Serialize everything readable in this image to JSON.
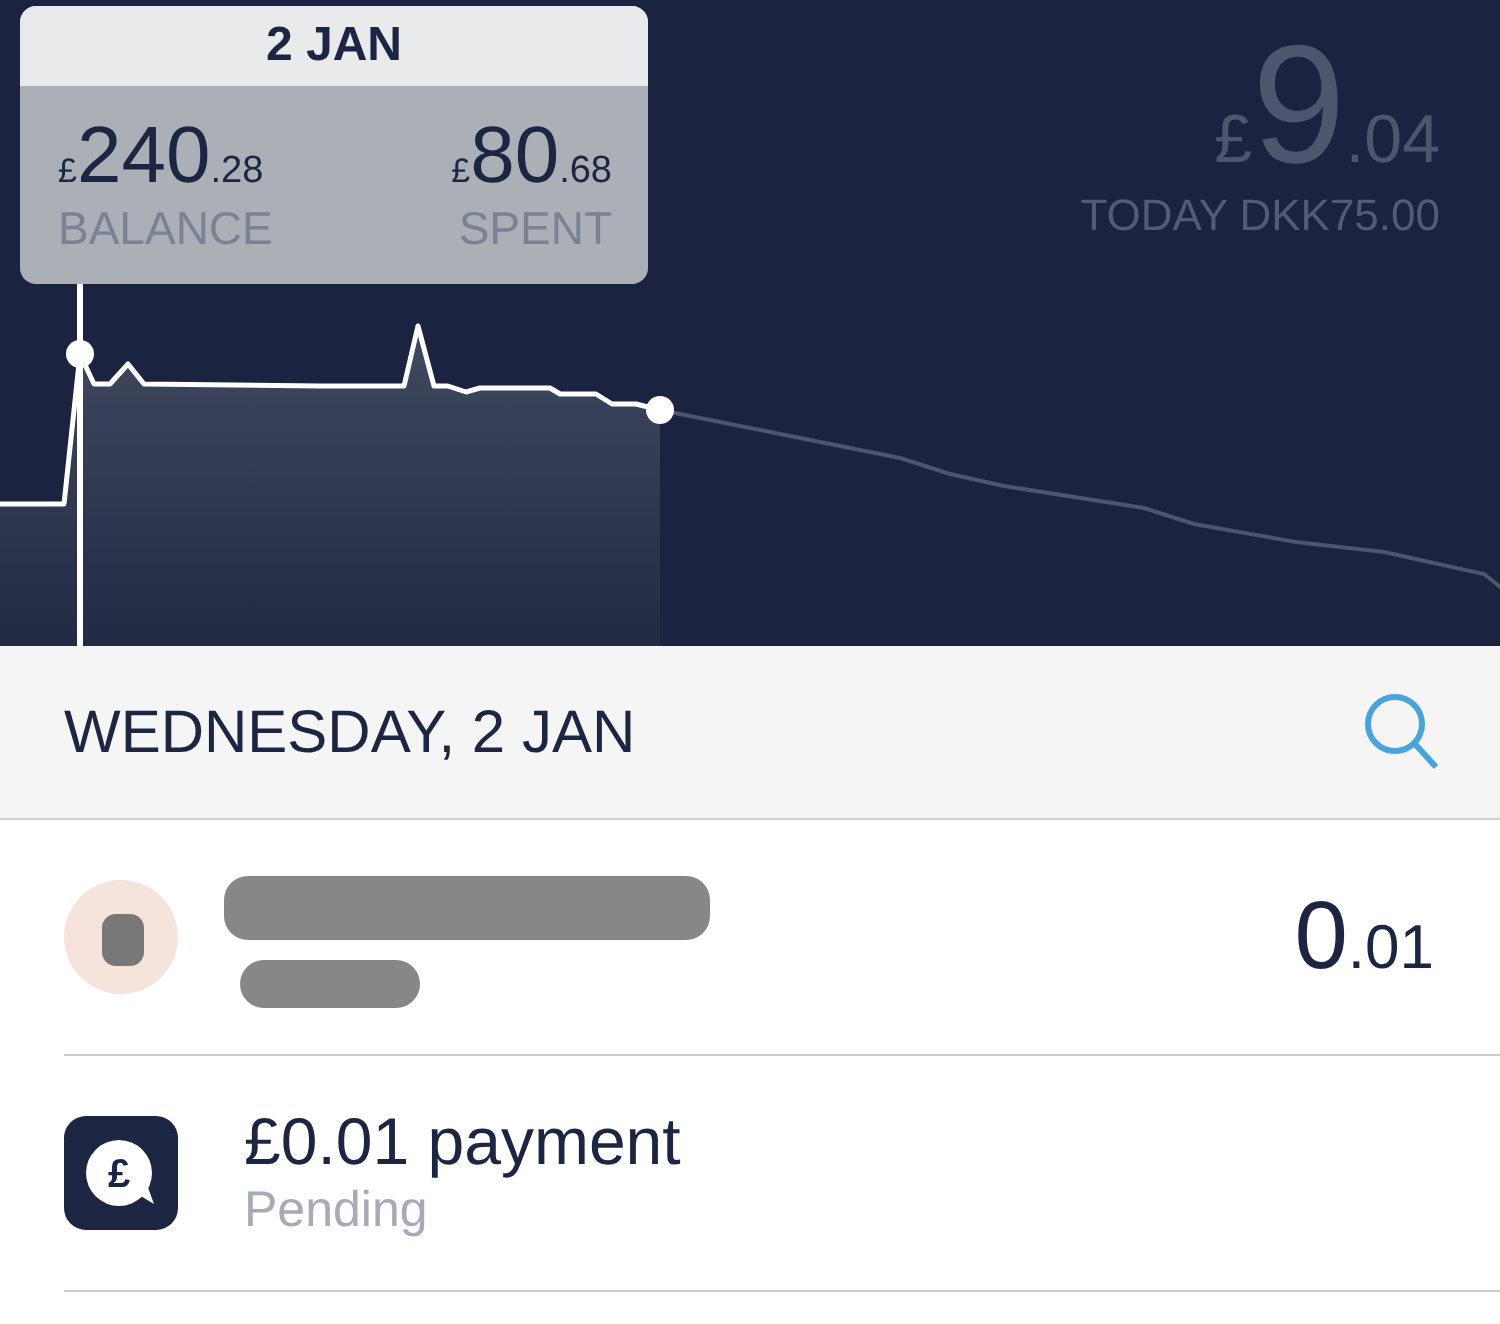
{
  "chart": {
    "tooltip": {
      "date": "2 JAN",
      "balance": {
        "currency": "£",
        "whole": "240",
        "fraction": ".28",
        "label": "BALANCE"
      },
      "spent": {
        "currency": "£",
        "whole": "80",
        "fraction": ".68",
        "label": "SPENT"
      }
    },
    "today": {
      "currency": "£",
      "whole": "9",
      "fraction": ".04",
      "label": "TODAY DKK75.00"
    }
  },
  "day_header": {
    "title": "WEDNESDAY, 2 JAN"
  },
  "transactions": [
    {
      "kind": "redacted",
      "amount": {
        "whole": "0",
        "fraction": ".01"
      }
    },
    {
      "kind": "payment",
      "icon_symbol": "£",
      "title": "£0.01 payment",
      "status": "Pending"
    }
  ]
}
